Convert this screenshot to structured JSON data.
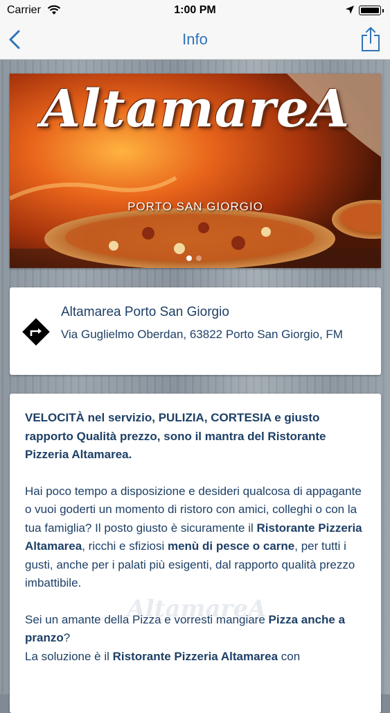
{
  "status_bar": {
    "carrier": "Carrier",
    "time": "1:00 PM"
  },
  "nav": {
    "title": "Info"
  },
  "banner": {
    "logo_text": "AltamareA",
    "subtitle": "PORTO SAN GIORGIO",
    "page_count": 2,
    "active_page": 1
  },
  "address": {
    "name": "Altamarea Porto San Giorgio",
    "line": "Via Guglielmo Oberdan, 63822 Porto San Giorgio, FM"
  },
  "description": {
    "p1": {
      "b1": "VELOCITÀ",
      "t1": "  nel servizio, ",
      "b2": "PULIZIA",
      "t2": ", ",
      "b3": "CORTESIA",
      "t3": " e ",
      "b4": "giusto rapporto Qualità prezzo, sono il mantra del Ristorante Pizzeria Altamarea."
    },
    "p2": {
      "t1": "Hai poco tempo a disposizione e desideri qualcosa di appagante o vuoi goderti un momento di ristoro con amici, colleghi o con la tua famiglia? Il posto giusto è sicuramente il ",
      "b1": "Ristorante Pizzeria Altamarea",
      "t2": ", ricchi e sfiziosi ",
      "b2": "menù di pesce o carne",
      "t3": ", per tutti i gusti, anche per i palati più esigenti, dal rapporto qualità prezzo imbattibile."
    },
    "p3": {
      "t1": "Sei un amante della Pizza e vorresti mangiare ",
      "b1": "Pizza anche a pranzo",
      "t2": "?",
      "t3": "La soluzione è il ",
      "b2": "Ristorante Pizzeria Altamarea",
      "t4": " con"
    },
    "watermark": "AltamareA"
  },
  "colors": {
    "accent": "#2f72b8",
    "text": "#1d3f66"
  }
}
